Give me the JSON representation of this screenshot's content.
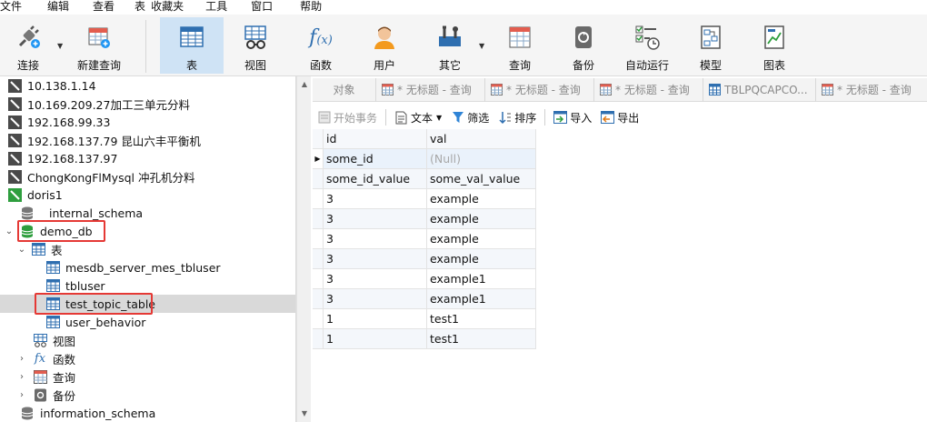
{
  "menu": [
    "文件",
    "编辑",
    "查看",
    "表",
    "收藏夹",
    "工具",
    "窗口",
    "帮助"
  ],
  "toolbar": {
    "connect": "连接",
    "new_query": "新建查询",
    "table": "表",
    "view": "视图",
    "function": "函数",
    "user": "用户",
    "other": "其它",
    "query": "查询",
    "backup": "备份",
    "auto_run": "自动运行",
    "model": "模型",
    "chart": "图表"
  },
  "tree": [
    {
      "label": "10.138.1.14",
      "type": "conn",
      "indent": 0
    },
    {
      "label": "10.169.209.27加工三单元分料",
      "type": "conn",
      "indent": 0
    },
    {
      "label": "192.168.99.33",
      "type": "conn",
      "indent": 0
    },
    {
      "label": "192.168.137.79 昆山六丰平衡机",
      "type": "conn",
      "indent": 0
    },
    {
      "label": "192.168.137.97",
      "type": "conn",
      "indent": 0
    },
    {
      "label": "ChongKongFlMysql 冲孔机分料",
      "type": "conn",
      "indent": 0
    },
    {
      "label": "doris1",
      "type": "conn-open",
      "indent": 0
    },
    {
      "label": "internal_schema",
      "type": "db",
      "indent": 1
    },
    {
      "label": "demo_db",
      "type": "db-open",
      "indent": 1
    },
    {
      "label": "表",
      "type": "tables",
      "indent": 2
    },
    {
      "label": "mesdb_server_mes_tbluser",
      "type": "table",
      "indent": 3
    },
    {
      "label": "tbluser",
      "type": "table",
      "indent": 3
    },
    {
      "label": "test_topic_table",
      "type": "table",
      "indent": 3
    },
    {
      "label": "user_behavior",
      "type": "table",
      "indent": 3
    },
    {
      "label": "视图",
      "type": "views",
      "indent": 2
    },
    {
      "label": "函数",
      "type": "funcs",
      "indent": 2
    },
    {
      "label": "查询",
      "type": "queries",
      "indent": 2
    },
    {
      "label": "备份",
      "type": "backups",
      "indent": 2
    },
    {
      "label": "information_schema",
      "type": "db",
      "indent": 1
    }
  ],
  "tabs": {
    "objects": "对象",
    "t1": "* 无标题 - 查询",
    "t2": "* 无标题 - 查询",
    "t3": "* 无标题 - 查询",
    "t4": "TBLPQCAPCO...",
    "t5": "* 无标题 - 查询"
  },
  "datatools": {
    "begin_tx": "开始事务",
    "text": "文本",
    "filter": "筛选",
    "sort": "排序",
    "import": "导入",
    "export": "导出"
  },
  "grid": {
    "columns": [
      "id",
      "val"
    ],
    "rows": [
      [
        "some_id",
        "(Null)"
      ],
      [
        "some_id_value",
        "some_val_value"
      ],
      [
        "3",
        "example"
      ],
      [
        "3",
        "example"
      ],
      [
        "3",
        "example"
      ],
      [
        "3",
        "example"
      ],
      [
        "3",
        "example1"
      ],
      [
        "3",
        "example1"
      ],
      [
        "1",
        "test1"
      ],
      [
        "1",
        "test1"
      ]
    ]
  },
  "colors": {
    "accent": "#1e88e5",
    "highlight_red": "#e53935",
    "selected_bg": "#d9d9d9",
    "toolbar_active": "#cfe3f5"
  }
}
